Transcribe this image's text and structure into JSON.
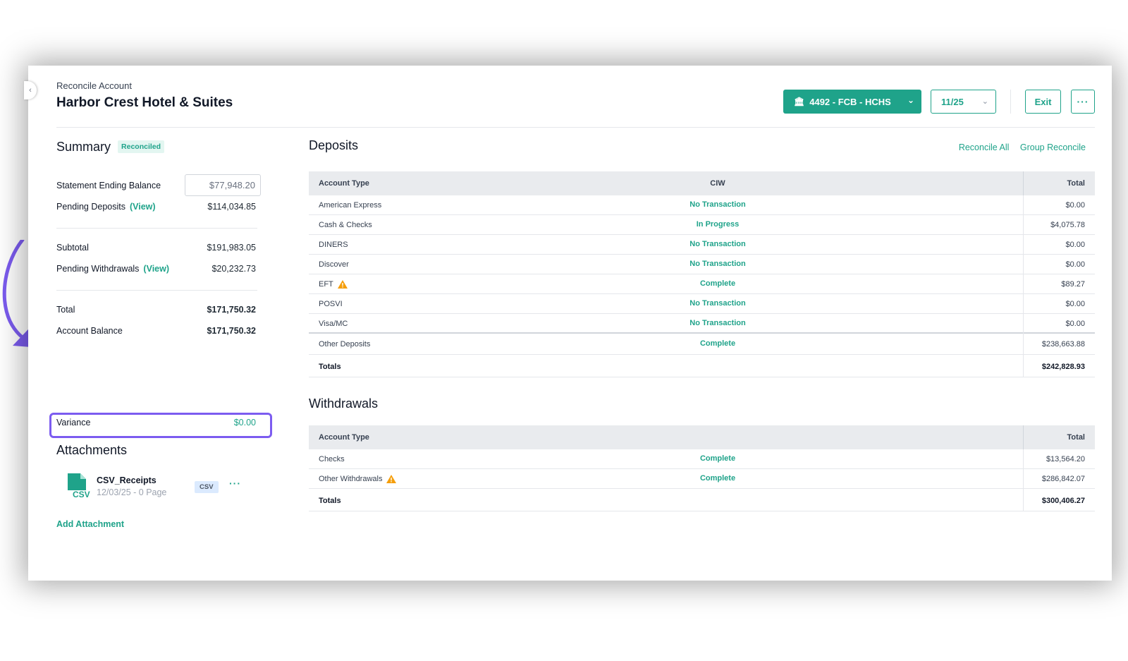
{
  "header": {
    "breadcrumb": "Reconcile Account",
    "title": "Harbor Crest Hotel & Suites",
    "account_label": "4492 - FCB - HCHS",
    "period_label": "11/25",
    "exit_label": "Exit",
    "more_label": "···"
  },
  "summary": {
    "title": "Summary",
    "status_badge": "Reconciled",
    "rows": {
      "statement_label": "Statement Ending Balance",
      "statement_value": "$77,948.20",
      "pending_deposits_label": "Pending Deposits",
      "pending_deposits_value": "$114,034.85",
      "view_label": "(View)",
      "subtotal_label": "Subtotal",
      "subtotal_value": "$191,983.05",
      "pending_withdrawals_label": "Pending Withdrawals",
      "pending_withdrawals_value": "$20,232.73",
      "total_label": "Total",
      "total_value": "$171,750.32",
      "account_balance_label": "Account Balance",
      "account_balance_value": "$171,750.32",
      "variance_label": "Variance",
      "variance_value": "$0.00"
    }
  },
  "attachments": {
    "title": "Attachments",
    "file_name": "CSV_Receipts",
    "file_meta": "12/03/25 - 0 Page",
    "file_tag": "CSV",
    "icon_text": "CSV",
    "more_label": "···",
    "add_label": "Add Attachment"
  },
  "deposits": {
    "title": "Deposits",
    "reconcile_all": "Reconcile All",
    "group_reconcile": "Group Reconcile",
    "headers": [
      "Account Type",
      "CIW",
      "Total"
    ],
    "rows": [
      {
        "type": "American Express",
        "status": "No Transaction",
        "total": "$0.00"
      },
      {
        "type": "Cash & Checks",
        "status": "In Progress",
        "total": "$4,075.78"
      },
      {
        "type": "DINERS",
        "status": "No Transaction",
        "total": "$0.00"
      },
      {
        "type": "Discover",
        "status": "No Transaction",
        "total": "$0.00"
      },
      {
        "type": "EFT",
        "status": "Complete",
        "total": "$89.27"
      },
      {
        "type": "POSVI",
        "status": "No Transaction",
        "total": "$0.00"
      },
      {
        "type": "Visa/MC",
        "status": "No Transaction",
        "total": "$0.00"
      },
      {
        "type": "Other Deposits",
        "status": "Complete",
        "total": "$238,663.88"
      }
    ],
    "totals_label": "Totals",
    "totals_value": "$242,828.93"
  },
  "withdrawals": {
    "title": "Withdrawals",
    "headers": [
      "Account Type",
      "Total"
    ],
    "rows": [
      {
        "type": "Checks",
        "status": "Complete",
        "total": "$13,564.20"
      },
      {
        "type": "Other Withdrawals",
        "status": "Complete",
        "total": "$286,842.07"
      }
    ],
    "totals_label": "Totals",
    "totals_value": "$300,406.27"
  },
  "icons": {
    "bank": "bank-icon",
    "chevron": "chevron-down-icon",
    "warning": "warning-icon",
    "file": "csv-file-icon",
    "arrow": "annotation-arrow"
  },
  "colors": {
    "accent": "#1fa38a",
    "highlight": "#7c5cf0",
    "warning": "#f59e0b"
  }
}
